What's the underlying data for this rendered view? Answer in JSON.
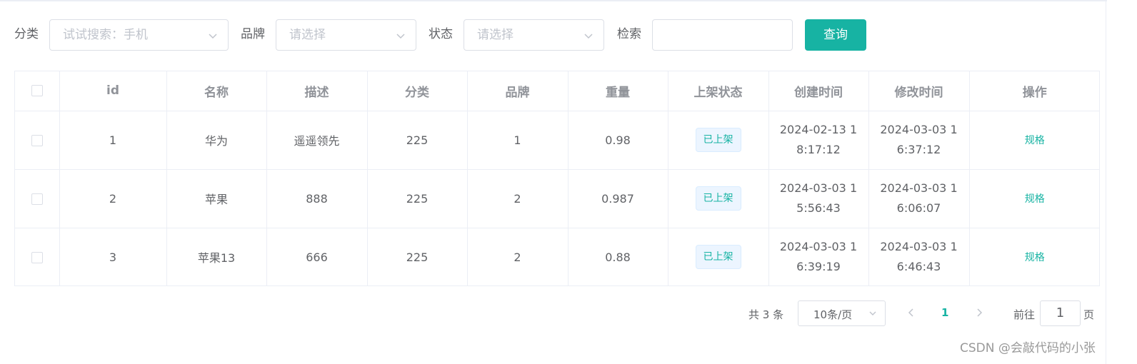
{
  "filters": {
    "category_label": "分类",
    "category_placeholder": "试试搜索：手机",
    "brand_label": "品牌",
    "brand_placeholder": "请选择",
    "status_label": "状态",
    "status_placeholder": "请选择",
    "search_label": "检索",
    "search_value": "",
    "query_button": "查询"
  },
  "table": {
    "columns": [
      "id",
      "名称",
      "描述",
      "分类",
      "品牌",
      "重量",
      "上架状态",
      "创建时间",
      "修改时间",
      "操作"
    ],
    "rows": [
      {
        "id": "1",
        "name": "华为",
        "desc": "遥遥领先",
        "category": "225",
        "brand": "1",
        "weight": "0.98",
        "status": "已上架",
        "created": "2024-02-13 18:17:12",
        "modified": "2024-03-03 16:37:12",
        "action": "规格"
      },
      {
        "id": "2",
        "name": "苹果",
        "desc": "888",
        "category": "225",
        "brand": "2",
        "weight": "0.987",
        "status": "已上架",
        "created": "2024-03-03 15:56:43",
        "modified": "2024-03-03 16:06:07",
        "action": "规格"
      },
      {
        "id": "3",
        "name": "苹果13",
        "desc": "666",
        "category": "225",
        "brand": "2",
        "weight": "0.88",
        "status": "已上架",
        "created": "2024-03-03 16:39:19",
        "modified": "2024-03-03 16:46:43",
        "action": "规格"
      }
    ]
  },
  "pagination": {
    "total": "共 3 条",
    "page_size": "10条/页",
    "current_page": "1",
    "goto_label": "前往",
    "goto_value": "1",
    "goto_unit": "页"
  },
  "watermark": "CSDN @会敲代码的小张",
  "colors": {
    "accent": "#17b3a3",
    "border": "#dcdfe6",
    "tag_bg": "#ecf5ff"
  },
  "icons": {
    "select_arrow": "chevron-down-icon",
    "prev": "chevron-left-icon",
    "next": "chevron-right-icon"
  }
}
